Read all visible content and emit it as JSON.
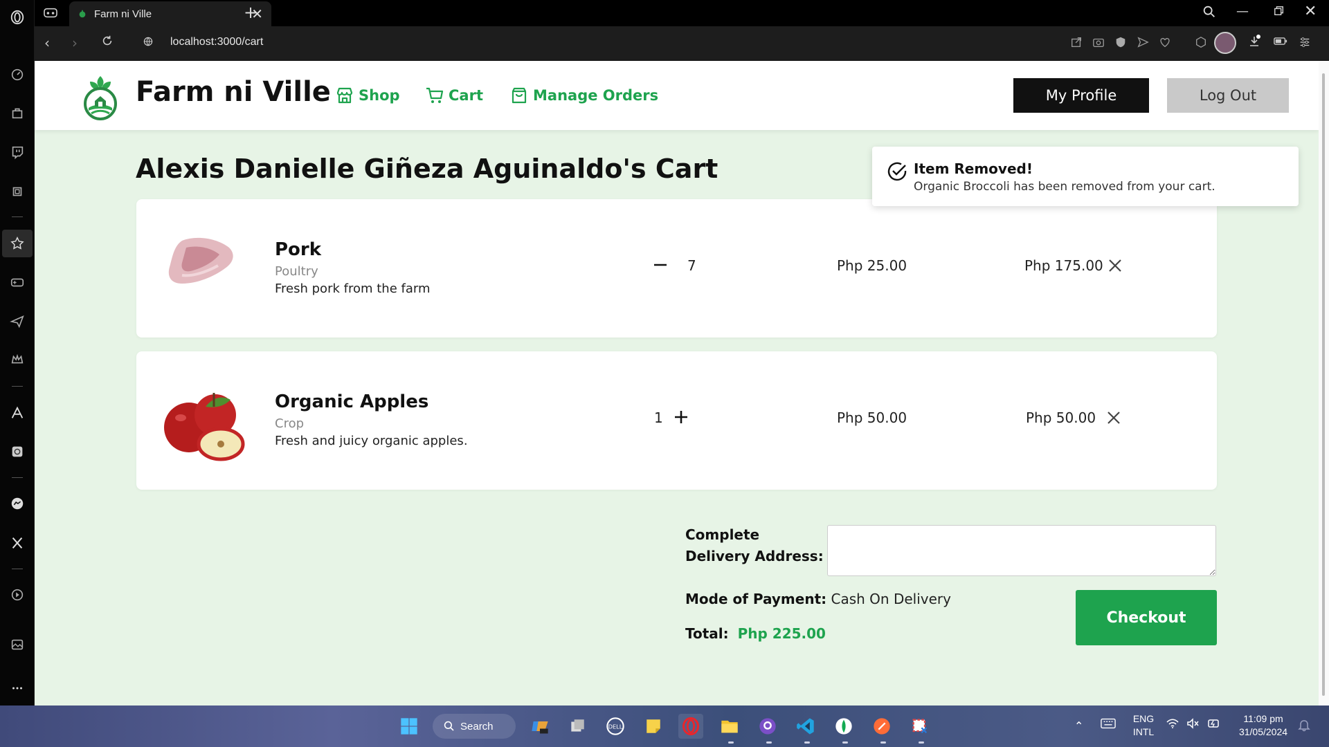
{
  "browser": {
    "tab_title": "Farm ni Ville",
    "url": "localhost:3000/cart"
  },
  "nav": {
    "brand": "Farm ni Ville",
    "links": [
      "Shop",
      "Cart",
      "Manage Orders"
    ],
    "profile_button": "My Profile",
    "logout_button": "Log Out"
  },
  "cart": {
    "title": "Alexis Danielle Giñeza Aguinaldo's Cart",
    "items": [
      {
        "name": "Pork",
        "category": "Poultry",
        "description": "Fresh pork from the farm",
        "quantity": "7",
        "price": "Php 25.00",
        "subtotal": "Php 175.00"
      },
      {
        "name": "Organic Apples",
        "category": "Crop",
        "description": "Fresh and juicy organic apples.",
        "quantity": "1",
        "price": "Php 50.00",
        "subtotal": "Php 50.00"
      }
    ],
    "address_label": "Complete Delivery Address:",
    "address_value": "",
    "payment_label": "Mode of Payment:",
    "payment_value": "Cash On Delivery",
    "total_label": "Total:",
    "total_value": "Php 225.00",
    "checkout_button": "Checkout"
  },
  "toast": {
    "title": "Item Removed!",
    "message": "Organic Broccoli has been removed from your cart."
  },
  "taskbar": {
    "search_label": "Search",
    "lang_line1": "ENG",
    "lang_line2": "INTL",
    "time": "11:09 pm",
    "date": "31/05/2024"
  },
  "colors": {
    "accent": "#1ea34e",
    "page_bg": "#e7f4e6",
    "dark_button": "#111111"
  }
}
